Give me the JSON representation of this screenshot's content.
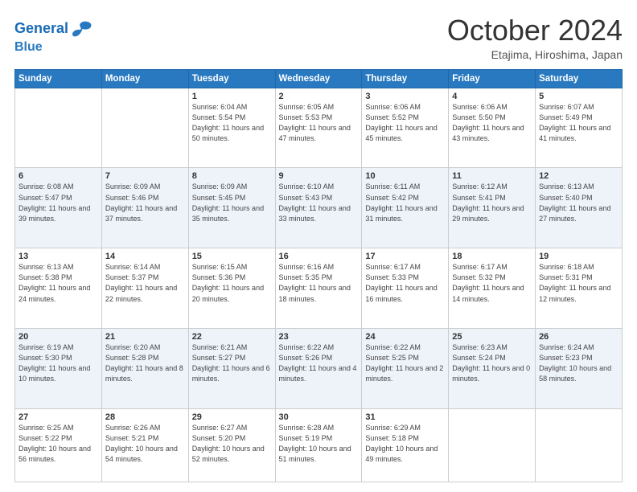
{
  "logo": {
    "line1": "General",
    "line2": "Blue"
  },
  "header": {
    "month": "October 2024",
    "location": "Etajima, Hiroshima, Japan"
  },
  "weekdays": [
    "Sunday",
    "Monday",
    "Tuesday",
    "Wednesday",
    "Thursday",
    "Friday",
    "Saturday"
  ],
  "weeks": [
    [
      {
        "day": "",
        "info": ""
      },
      {
        "day": "",
        "info": ""
      },
      {
        "day": "1",
        "info": "Sunrise: 6:04 AM\nSunset: 5:54 PM\nDaylight: 11 hours and 50 minutes."
      },
      {
        "day": "2",
        "info": "Sunrise: 6:05 AM\nSunset: 5:53 PM\nDaylight: 11 hours and 47 minutes."
      },
      {
        "day": "3",
        "info": "Sunrise: 6:06 AM\nSunset: 5:52 PM\nDaylight: 11 hours and 45 minutes."
      },
      {
        "day": "4",
        "info": "Sunrise: 6:06 AM\nSunset: 5:50 PM\nDaylight: 11 hours and 43 minutes."
      },
      {
        "day": "5",
        "info": "Sunrise: 6:07 AM\nSunset: 5:49 PM\nDaylight: 11 hours and 41 minutes."
      }
    ],
    [
      {
        "day": "6",
        "info": "Sunrise: 6:08 AM\nSunset: 5:47 PM\nDaylight: 11 hours and 39 minutes."
      },
      {
        "day": "7",
        "info": "Sunrise: 6:09 AM\nSunset: 5:46 PM\nDaylight: 11 hours and 37 minutes."
      },
      {
        "day": "8",
        "info": "Sunrise: 6:09 AM\nSunset: 5:45 PM\nDaylight: 11 hours and 35 minutes."
      },
      {
        "day": "9",
        "info": "Sunrise: 6:10 AM\nSunset: 5:43 PM\nDaylight: 11 hours and 33 minutes."
      },
      {
        "day": "10",
        "info": "Sunrise: 6:11 AM\nSunset: 5:42 PM\nDaylight: 11 hours and 31 minutes."
      },
      {
        "day": "11",
        "info": "Sunrise: 6:12 AM\nSunset: 5:41 PM\nDaylight: 11 hours and 29 minutes."
      },
      {
        "day": "12",
        "info": "Sunrise: 6:13 AM\nSunset: 5:40 PM\nDaylight: 11 hours and 27 minutes."
      }
    ],
    [
      {
        "day": "13",
        "info": "Sunrise: 6:13 AM\nSunset: 5:38 PM\nDaylight: 11 hours and 24 minutes."
      },
      {
        "day": "14",
        "info": "Sunrise: 6:14 AM\nSunset: 5:37 PM\nDaylight: 11 hours and 22 minutes."
      },
      {
        "day": "15",
        "info": "Sunrise: 6:15 AM\nSunset: 5:36 PM\nDaylight: 11 hours and 20 minutes."
      },
      {
        "day": "16",
        "info": "Sunrise: 6:16 AM\nSunset: 5:35 PM\nDaylight: 11 hours and 18 minutes."
      },
      {
        "day": "17",
        "info": "Sunrise: 6:17 AM\nSunset: 5:33 PM\nDaylight: 11 hours and 16 minutes."
      },
      {
        "day": "18",
        "info": "Sunrise: 6:17 AM\nSunset: 5:32 PM\nDaylight: 11 hours and 14 minutes."
      },
      {
        "day": "19",
        "info": "Sunrise: 6:18 AM\nSunset: 5:31 PM\nDaylight: 11 hours and 12 minutes."
      }
    ],
    [
      {
        "day": "20",
        "info": "Sunrise: 6:19 AM\nSunset: 5:30 PM\nDaylight: 11 hours and 10 minutes."
      },
      {
        "day": "21",
        "info": "Sunrise: 6:20 AM\nSunset: 5:28 PM\nDaylight: 11 hours and 8 minutes."
      },
      {
        "day": "22",
        "info": "Sunrise: 6:21 AM\nSunset: 5:27 PM\nDaylight: 11 hours and 6 minutes."
      },
      {
        "day": "23",
        "info": "Sunrise: 6:22 AM\nSunset: 5:26 PM\nDaylight: 11 hours and 4 minutes."
      },
      {
        "day": "24",
        "info": "Sunrise: 6:22 AM\nSunset: 5:25 PM\nDaylight: 11 hours and 2 minutes."
      },
      {
        "day": "25",
        "info": "Sunrise: 6:23 AM\nSunset: 5:24 PM\nDaylight: 11 hours and 0 minutes."
      },
      {
        "day": "26",
        "info": "Sunrise: 6:24 AM\nSunset: 5:23 PM\nDaylight: 10 hours and 58 minutes."
      }
    ],
    [
      {
        "day": "27",
        "info": "Sunrise: 6:25 AM\nSunset: 5:22 PM\nDaylight: 10 hours and 56 minutes."
      },
      {
        "day": "28",
        "info": "Sunrise: 6:26 AM\nSunset: 5:21 PM\nDaylight: 10 hours and 54 minutes."
      },
      {
        "day": "29",
        "info": "Sunrise: 6:27 AM\nSunset: 5:20 PM\nDaylight: 10 hours and 52 minutes."
      },
      {
        "day": "30",
        "info": "Sunrise: 6:28 AM\nSunset: 5:19 PM\nDaylight: 10 hours and 51 minutes."
      },
      {
        "day": "31",
        "info": "Sunrise: 6:29 AM\nSunset: 5:18 PM\nDaylight: 10 hours and 49 minutes."
      },
      {
        "day": "",
        "info": ""
      },
      {
        "day": "",
        "info": ""
      }
    ]
  ]
}
